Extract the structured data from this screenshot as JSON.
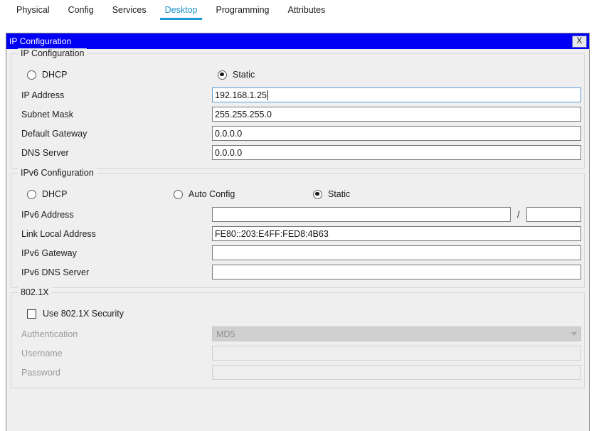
{
  "tabs": [
    {
      "label": "Physical",
      "active": false
    },
    {
      "label": "Config",
      "active": false
    },
    {
      "label": "Services",
      "active": false
    },
    {
      "label": "Desktop",
      "active": true
    },
    {
      "label": "Programming",
      "active": false
    },
    {
      "label": "Attributes",
      "active": false
    }
  ],
  "dialog": {
    "title": "IP Configuration",
    "close_label": "X"
  },
  "ipv4": {
    "group_title": "IP Configuration",
    "mode_dhcp_label": "DHCP",
    "mode_dhcp_selected": false,
    "mode_static_label": "Static",
    "mode_static_selected": true,
    "fields": [
      {
        "label": "IP Address",
        "value": "192.168.1.25",
        "focused": true
      },
      {
        "label": "Subnet Mask",
        "value": "255.255.255.0",
        "focused": false
      },
      {
        "label": "Default Gateway",
        "value": "0.0.0.0",
        "focused": false
      },
      {
        "label": "DNS Server",
        "value": "0.0.0.0",
        "focused": false
      }
    ]
  },
  "ipv6": {
    "group_title": "IPv6 Configuration",
    "mode_dhcp_label": "DHCP",
    "mode_dhcp_selected": false,
    "mode_auto_label": "Auto Config",
    "mode_auto_selected": false,
    "mode_static_label": "Static",
    "mode_static_selected": true,
    "address_label": "IPv6 Address",
    "address_value": "",
    "prefix_separator": "/",
    "prefix_value": "",
    "link_local_label": "Link Local Address",
    "link_local_value": "FE80::203:E4FF:FED8:4B63",
    "gateway_label": "IPv6 Gateway",
    "gateway_value": "",
    "dns_label": "IPv6 DNS Server",
    "dns_value": ""
  },
  "dot1x": {
    "group_title": "802.1X",
    "use_security_label": "Use 802.1X Security",
    "use_security_checked": false,
    "authentication_label": "Authentication",
    "authentication_value": "MD5",
    "username_label": "Username",
    "username_value": "",
    "password_label": "Password",
    "password_value": ""
  },
  "colors": {
    "titlebar": "#0000f5",
    "tab_active": "#1b8ec6",
    "focus_border": "#5b9bd5",
    "window_bg": "#efefef"
  }
}
